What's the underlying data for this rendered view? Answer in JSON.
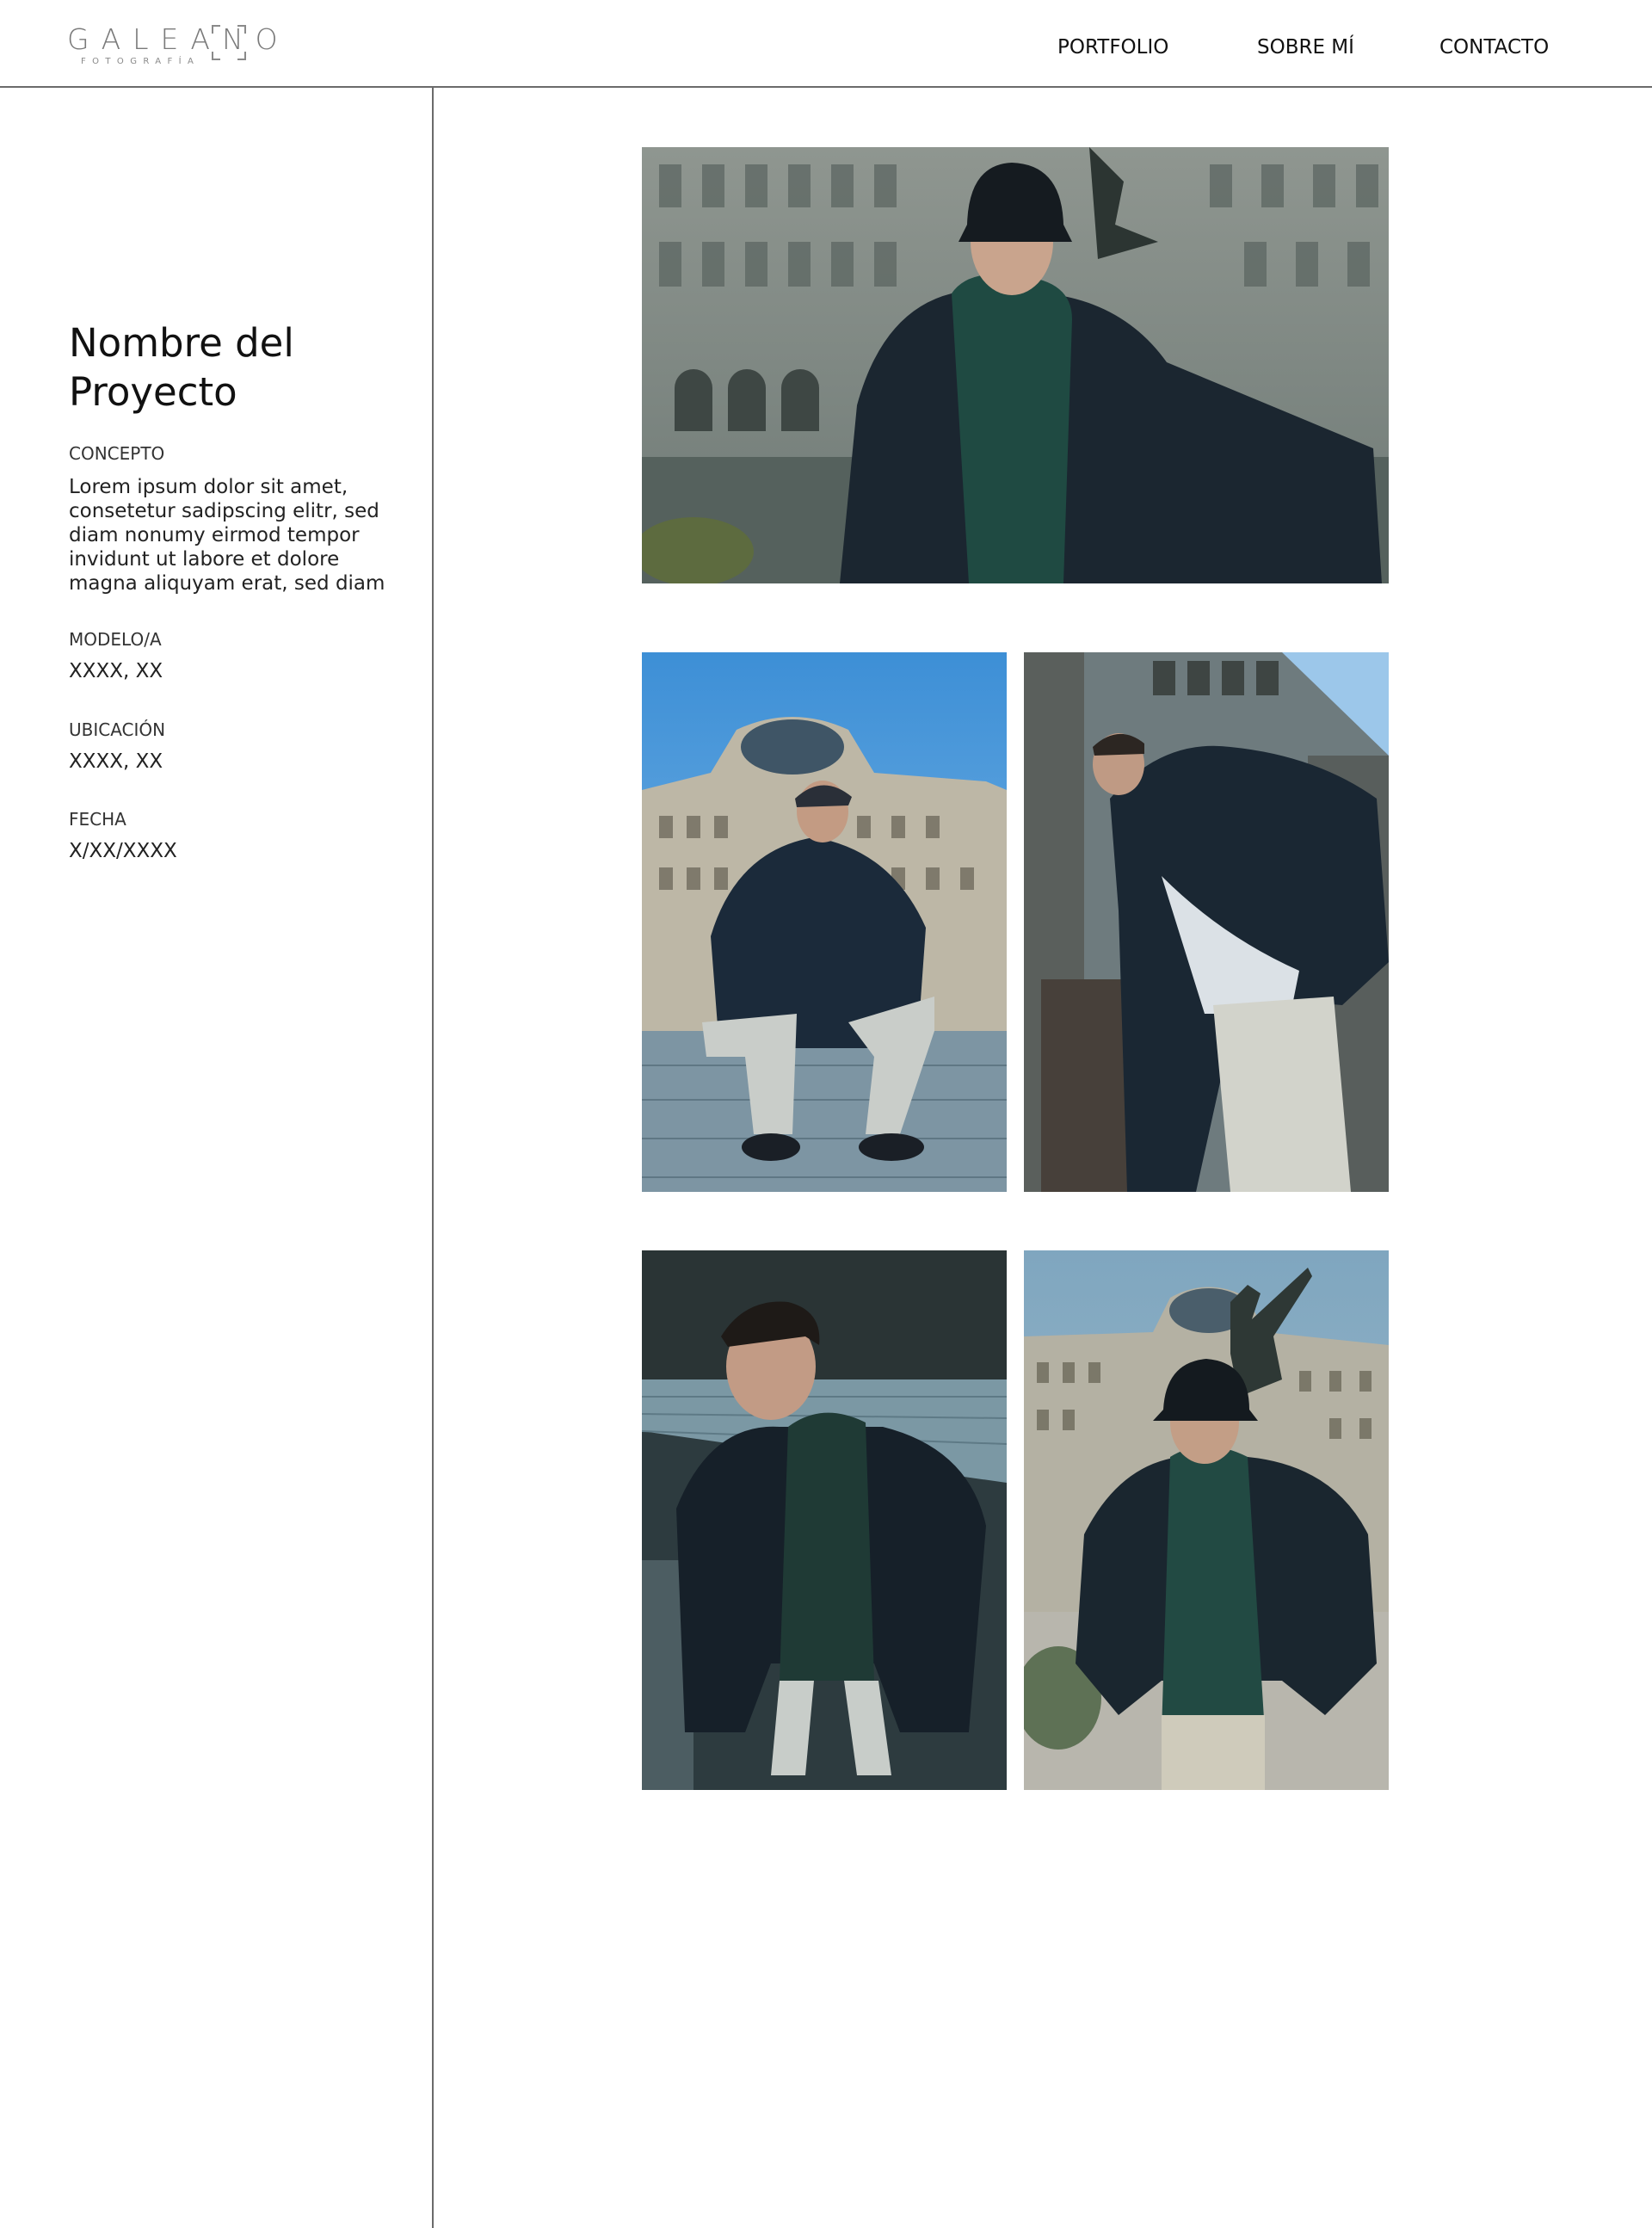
{
  "brand": {
    "name": "GALEANO",
    "tagline": "FOTOGRAFÍA"
  },
  "nav": {
    "portfolio": "PORTFOLIO",
    "sobre": "SOBRE MÍ",
    "contacto": "CONTACTO"
  },
  "project": {
    "title": "Nombre del Proyecto",
    "concept_label": "CONCEPTO",
    "concept_text": "Lorem ipsum dolor sit amet, consetetur sadipscing elitr, sed diam nonumy eirmod tempor invidunt ut labore et dolore magna aliquyam erat, sed diam",
    "model_label": "MODELO/A",
    "model_value": "XXXX, XX",
    "location_label": "UBICACIÓN",
    "location_value": "XXXX, XX",
    "date_label": "FECHA",
    "date_value": "X/XX/XXXX"
  },
  "colors": {
    "rule": "#6b6b6b",
    "sky": "#5aa0d8",
    "building": "#a9a89b",
    "jacket": "#1b2630",
    "hoodie": "#1f4a42",
    "pavement": "#8fa3ad"
  }
}
